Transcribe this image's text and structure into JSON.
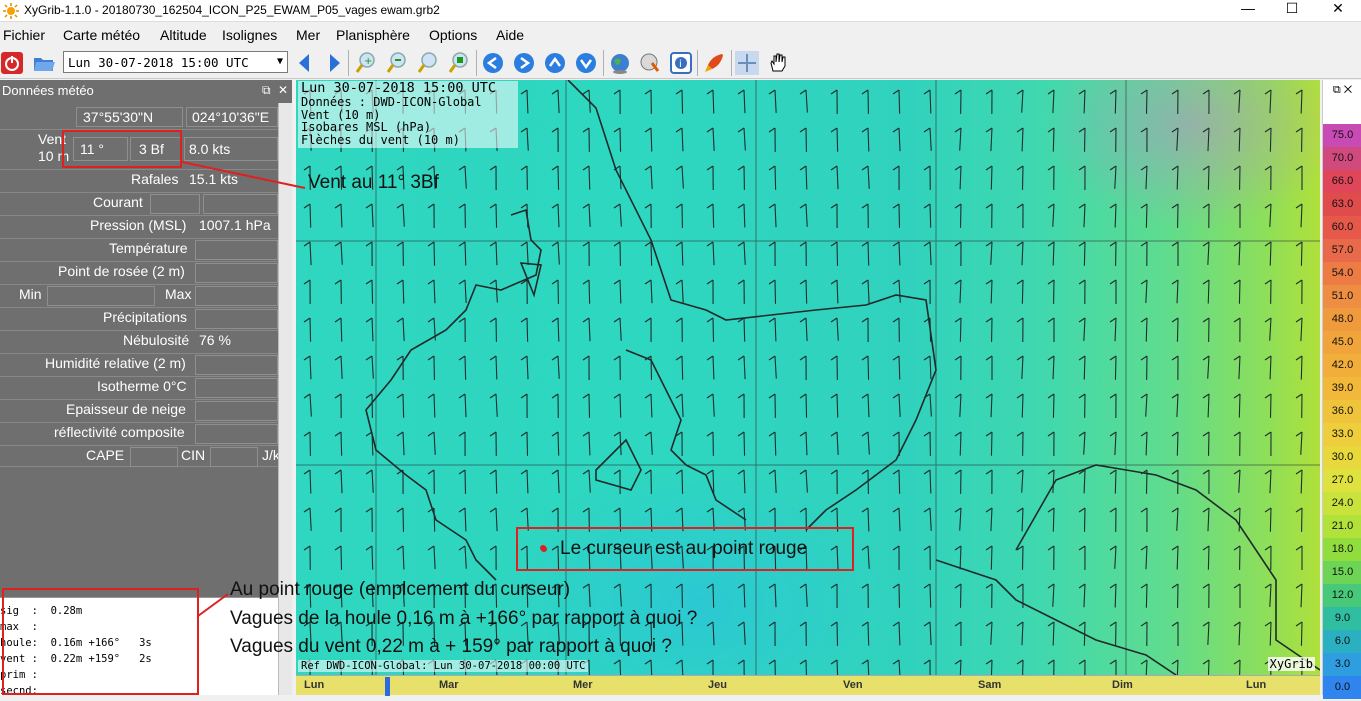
{
  "window": {
    "title": "XyGrib-1.1.0 - 20180730_162504_ICON_P25_EWAM_P05_vages ewam.grb2",
    "minimize": "—",
    "maximize": "☐",
    "close": "✕"
  },
  "menu": [
    "Fichier",
    "Carte météo",
    "Altitude",
    "Isolignes",
    "Mer",
    "Planisphère",
    "Options",
    "Aide"
  ],
  "toolbar": {
    "date_value": "Lun 30-07-2018 15:00 UTC",
    "icons": [
      "quit-icon",
      "open-file-icon",
      "prev-arrow-icon",
      "next-arrow-icon",
      "zoom-in-icon",
      "zoom-out-icon",
      "zoom-area-icon",
      "zoom-fit-icon",
      "arrow-left-icon",
      "arrow-right-icon",
      "arrow-up-icon",
      "arrow-down-icon",
      "globe-icon",
      "download-icon",
      "info-icon",
      "rocket-icon",
      "crosshair-icon",
      "hand-icon"
    ]
  },
  "left_panel": {
    "title": "Données météo",
    "lat": "37°55'30\"N",
    "lon": "024°10'36\"E",
    "wind_label_1": "Vent",
    "wind_label_2": "10 m",
    "wind_dir": "11 °",
    "wind_bf": "3 Bf",
    "wind_kts": "8.0  kts",
    "gusts_label": "Rafales",
    "gusts_value": "15.1  kts",
    "current_label": "Courant",
    "pressure_label": "Pression (MSL)",
    "pressure_value": "1007.1 hPa",
    "temperature_label": "Température",
    "dewpoint_label": "Point de rosée (2 m)",
    "min_label": "Min",
    "max_label": "Max",
    "precip_label": "Précipitations",
    "cloud_label": "Nébulosité",
    "cloud_value": "76 %",
    "humidity_label": "Humidité relative (2 m)",
    "isotherm_label": "Isotherme 0°C",
    "snow_label": "Epaisseur de neige",
    "reflectivity_label": "réflectivité composite",
    "cape_label": "CAPE",
    "cin_label": "CIN",
    "jkg_label": "J/k",
    "text_lines": [
      "sig  :  0.28m",
      "max  :",
      "houle:  0.16m +166°   3s",
      "vent :  0.22m +159°   2s",
      "prim :",
      "secnd:"
    ]
  },
  "map": {
    "overlay_date": "Lun 30-07-2018 15:00 UTC",
    "overlay_lines": [
      "Données : DWD-ICON-Global",
      "Vent (10 m)",
      "Isobares MSL (hPa)",
      "Flèches du vent (10 m)"
    ],
    "ref_line": "Ref DWD-ICON-Global: Lun 30-07-2018 00:00 UTC",
    "brand": "XyGrib",
    "timeline_days": [
      "Lun",
      "Mar",
      "Mer",
      "Jeu",
      "Ven",
      "Sam",
      "Dim",
      "Lun"
    ]
  },
  "colorbar": {
    "values": [
      "75.0",
      "70.0",
      "66.0",
      "63.0",
      "60.0",
      "57.0",
      "54.0",
      "51.0",
      "48.0",
      "45.0",
      "42.0",
      "39.0",
      "36.0",
      "33.0",
      "30.0",
      "27.0",
      "24.0",
      "21.0",
      "18.0",
      "15.0",
      "12.0",
      "9.0",
      "6.0",
      "3.0",
      "0.0"
    ],
    "colors": [
      "#c84ab4",
      "#d04a7e",
      "#e0465a",
      "#e04c4c",
      "#e5584a",
      "#e86a4a",
      "#ec7c44",
      "#ee8e42",
      "#f09a3e",
      "#f2a43c",
      "#f2ae3a",
      "#f2b83a",
      "#f0c43a",
      "#eece3c",
      "#e8d83c",
      "#dfe13e",
      "#c9e33c",
      "#b0e23a",
      "#92dd3e",
      "#6ed456",
      "#48c97a",
      "#2fbfa0",
      "#2ab0c0",
      "#2f9ee0",
      "#2f84ee"
    ]
  },
  "annotations": {
    "wind_note": "Vent au 11°  3Bf",
    "cursor_note": "Le curseur est au point rouge",
    "wave_notes": [
      "Au point rouge (emplcement du curseur)",
      "Vagues de la houle 0,16 m à +166° par rapport à quoi ?",
      "Vagues du vent 0,22 m à + 159° par rapport à quoi ?"
    ]
  }
}
